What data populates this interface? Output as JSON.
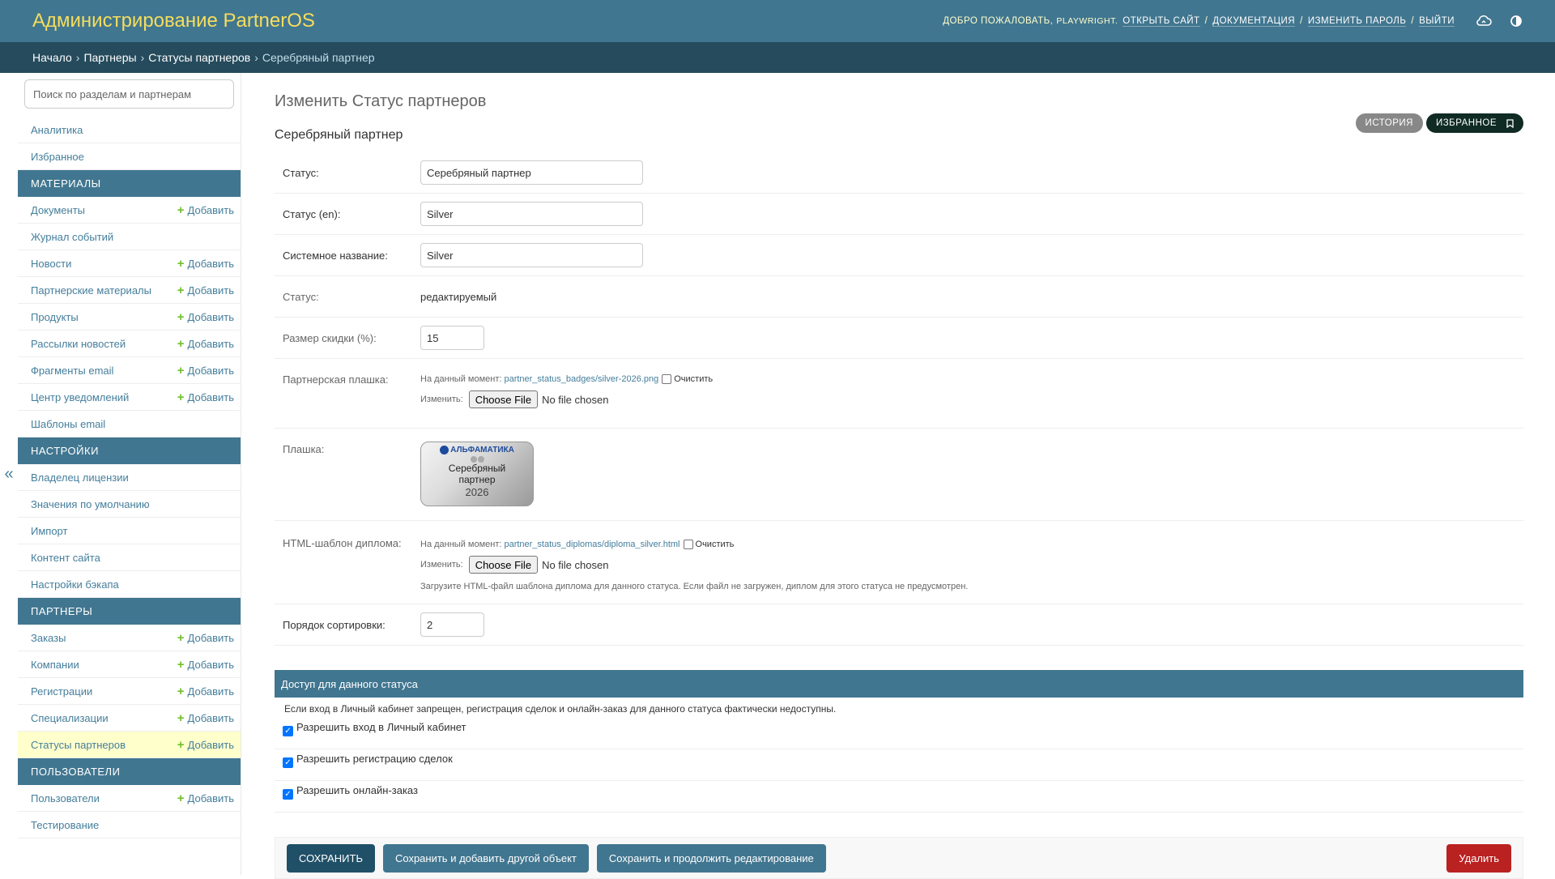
{
  "header": {
    "branding": "Администрирование PartnerOS",
    "welcome": "Добро пожаловать,",
    "username": "PLAYWRIGHT.",
    "links": [
      "Открыть сайт",
      "Документация",
      "Изменить пароль",
      "Выйти"
    ],
    "separator": "/",
    "icons": [
      "cloud-sync-icon",
      "theme-toggle-icon"
    ]
  },
  "breadcrumbs": {
    "items": [
      "Начало",
      "Партнеры",
      "Статусы партнеров"
    ],
    "current": "Серебряный партнер",
    "arrow": "›"
  },
  "sidebar": {
    "toggle": "«",
    "filter_placeholder": "Поиск по разделам и партнерам",
    "add_label": "Добавить",
    "top_items": [
      "Аналитика",
      "Избранное"
    ],
    "sections": [
      {
        "caption": "Материалы",
        "items": [
          {
            "label": "Документы",
            "add": true
          },
          {
            "label": "Журнал событий",
            "add": false
          },
          {
            "label": "Новости",
            "add": true
          },
          {
            "label": "Партнерские материалы",
            "add": true
          },
          {
            "label": "Продукты",
            "add": true
          },
          {
            "label": "Рассылки новостей",
            "add": true
          },
          {
            "label": "Фрагменты email",
            "add": true
          },
          {
            "label": "Центр уведомлений",
            "add": true
          },
          {
            "label": "Шаблоны email",
            "add": false
          }
        ]
      },
      {
        "caption": "Настройки",
        "items": [
          {
            "label": "Владелец лицензии",
            "add": false
          },
          {
            "label": "Значения по умолчанию",
            "add": false
          },
          {
            "label": "Импорт",
            "add": false
          },
          {
            "label": "Контент сайта",
            "add": false
          },
          {
            "label": "Настройки бэкапа",
            "add": false
          }
        ]
      },
      {
        "caption": "Партнеры",
        "items": [
          {
            "label": "Заказы",
            "add": true
          },
          {
            "label": "Компании",
            "add": true
          },
          {
            "label": "Регистрации",
            "add": true
          },
          {
            "label": "Специализации",
            "add": true
          },
          {
            "label": "Статусы партнеров",
            "add": true,
            "current": true
          }
        ]
      },
      {
        "caption": "Пользователи",
        "items": [
          {
            "label": "Пользователи",
            "add": true
          },
          {
            "label": "Тестирование",
            "add": false
          }
        ]
      }
    ]
  },
  "content": {
    "title": "Изменить Статус партнеров",
    "object_name": "Серебряный партнер",
    "tools": {
      "history": "История",
      "favorite": "Избранное"
    },
    "fields": {
      "status_label": "Статус:",
      "status_value": "Серебряный партнер",
      "status_en_label": "Статус (en):",
      "status_en_value": "Silver",
      "system_name_label": "Системное название:",
      "system_name_value": "Silver",
      "state_label": "Статус:",
      "state_value": "редактируемый",
      "discount_label": "Размер скидки (%):",
      "discount_value": "15",
      "badge_file_label": "Партнерская плашка:",
      "currently": "На данный момент:",
      "badge_file_path": "partner_status_badges/silver-2026.png",
      "clear": "Очистить",
      "change": "Изменить:",
      "choose_file": "Choose File",
      "no_file": "No file chosen",
      "badge_label": "Плашка:",
      "badge_logo_text": "АЛЬФАМАТИКА",
      "badge_line1": "Серебряный",
      "badge_line2": "партнер",
      "badge_year": "2026",
      "diploma_label": "HTML-шаблон диплома:",
      "diploma_path": "partner_status_diplomas/diploma_silver.html",
      "diploma_help": "Загрузите HTML-файл шаблона диплома для данного статуса. Если файл не загружен, диплом для этого статуса не предусмотрен.",
      "sort_label": "Порядок сортировки:",
      "sort_value": "2"
    },
    "access": {
      "title": "Доступ для данного статуса",
      "description": "Если вход в Личный кабинет запрещен, регистрация сделок и онлайн-заказ для данного статуса фактически недоступны.",
      "checks": [
        {
          "label": "Разрешить вход в Личный кабинет",
          "checked": true
        },
        {
          "label": "Разрешить регистрацию сделок",
          "checked": true
        },
        {
          "label": "Разрешить онлайн-заказ",
          "checked": true
        }
      ]
    },
    "submit": {
      "save": "Сохранить",
      "save_add": "Сохранить и добавить другой объект",
      "save_continue": "Сохранить и продолжить редактирование",
      "delete": "Удалить"
    }
  },
  "colors": {
    "header_bg": "#417690",
    "breadcrumbs_bg": "#264b5d",
    "branding": "#f5dd5d",
    "link": "#447e9b",
    "current_row": "#ffffcc",
    "delete": "#ba2121"
  }
}
